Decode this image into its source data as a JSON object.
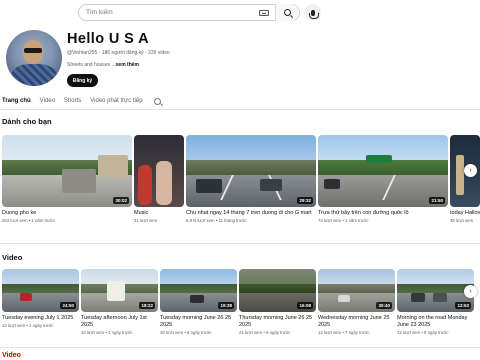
{
  "search": {
    "placeholder": "Tìm kiếm"
  },
  "channel": {
    "title": "Hello U S A",
    "handle_meta": "@Vinhtan255 · 186 người đăng ký · 239 video",
    "description": "Streets and houses ...",
    "more_label": "xem thêm",
    "subscribe_label": "Đăng ký"
  },
  "tabs": [
    "Trang chủ",
    "Video",
    "Shorts",
    "Video phát trực tiếp"
  ],
  "for_you": {
    "title": "Dành cho bạn",
    "cards": [
      {
        "title": "Duong pho ke",
        "meta": "253 lượt xem • 1 năm trước",
        "duration": "30:02"
      },
      {
        "title": "Music",
        "meta": "31 lượt xem",
        "duration": ""
      },
      {
        "title": "Chu nhat ngay 14 thang 7 tren duong di cho G mart",
        "meta": "6,9 N lượt xem • 11 tháng trước",
        "duration": "29:32"
      },
      {
        "title": "Trưa thứ bảy trên con đường quốc lộ",
        "meta": "74 lượt xem • 1 năm trước",
        "duration": "21:50"
      },
      {
        "title": "today Hallov",
        "meta": "45 lượt xem",
        "duration": ""
      }
    ]
  },
  "videos": {
    "title": "Video",
    "cards": [
      {
        "title1": "Tuesday evening July 1 2025",
        "title2": "",
        "meta": "13 lượt xem • 1 ngày trước",
        "duration": "24:50"
      },
      {
        "title1": "Tuesday afternoon July 1st",
        "title2": "2025",
        "meta": "10 lượt xem • 1 ngày trước",
        "duration": "18:22"
      },
      {
        "title1": "Tuesday morning June 26 25",
        "title2": "2025",
        "meta": "30 lượt xem • 6 ngày trước",
        "duration": "19:38"
      },
      {
        "title1": "Thursday morning June 26 25",
        "title2": "2025",
        "meta": "21 lượt xem • 6 ngày trước",
        "duration": "16:08"
      },
      {
        "title1": "Wednesday morning June 25",
        "title2": "2025",
        "meta": "12 lượt xem • 7 ngày trước",
        "duration": "30:40"
      },
      {
        "title1": "Morning on the road Monday",
        "title2": "June 23 2025",
        "meta": "12 lượt xem • 9 ngày trước",
        "duration": "12:53"
      }
    ]
  },
  "bottom_section": {
    "title": "Video"
  },
  "colors": {
    "subscribe_bg": "#0f0f0f",
    "text": "#0f0f0f",
    "muted": "#606060"
  }
}
